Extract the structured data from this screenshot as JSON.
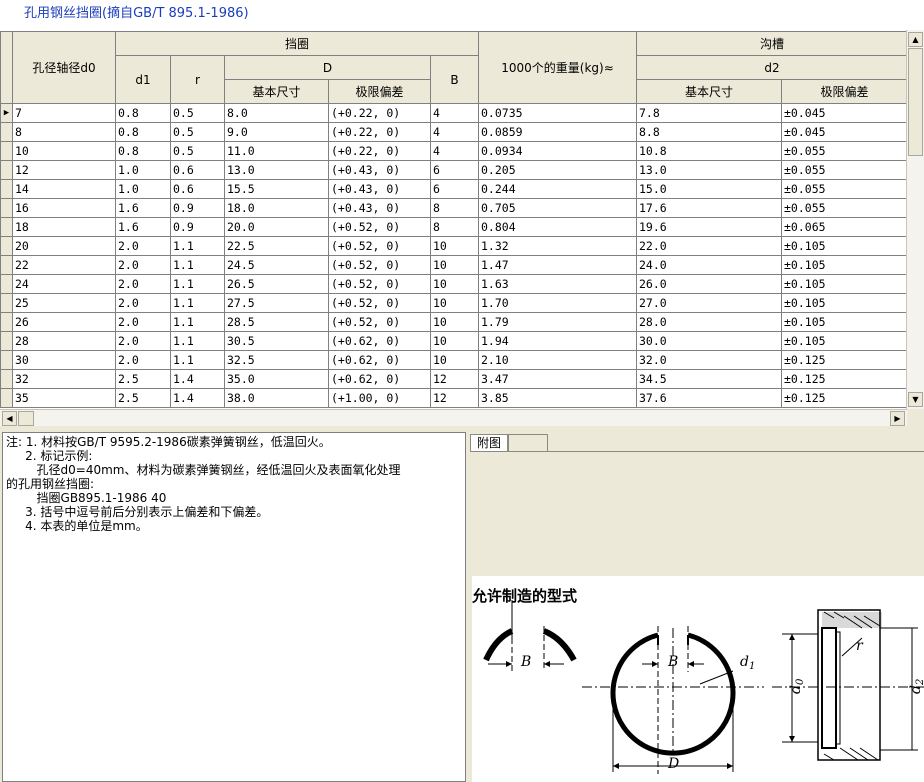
{
  "title": "孔用钢丝挡圈(摘自GB/T 895.1-1986)",
  "grid": {
    "headers": {
      "hole_dia": "孔径轴径d0",
      "ring": "挡圈",
      "d1": "d1",
      "r": "r",
      "D": "D",
      "basic": "基本尺寸",
      "tolerance": "极限偏差",
      "B": "B",
      "weight": "1000个的重量(kg)≈",
      "groove": "沟槽",
      "d2": "d2",
      "g_basic": "基本尺寸",
      "g_tolerance": "极限偏差"
    },
    "current_row_marker": "▶",
    "rows": [
      [
        "7",
        "0.8",
        "0.5",
        "8.0",
        "(+0.22, 0)",
        "4",
        "0.0735",
        "7.8",
        "±0.045"
      ],
      [
        "8",
        "0.8",
        "0.5",
        "9.0",
        "(+0.22, 0)",
        "4",
        "0.0859",
        "8.8",
        "±0.045"
      ],
      [
        "10",
        "0.8",
        "0.5",
        "11.0",
        "(+0.22, 0)",
        "4",
        "0.0934",
        "10.8",
        "±0.055"
      ],
      [
        "12",
        "1.0",
        "0.6",
        "13.0",
        "(+0.43, 0)",
        "6",
        "0.205",
        "13.0",
        "±0.055"
      ],
      [
        "14",
        "1.0",
        "0.6",
        "15.5",
        "(+0.43, 0)",
        "6",
        "0.244",
        "15.0",
        "±0.055"
      ],
      [
        "16",
        "1.6",
        "0.9",
        "18.0",
        "(+0.43, 0)",
        "8",
        "0.705",
        "17.6",
        "±0.055"
      ],
      [
        "18",
        "1.6",
        "0.9",
        "20.0",
        "(+0.52, 0)",
        "8",
        "0.804",
        "19.6",
        "±0.065"
      ],
      [
        "20",
        "2.0",
        "1.1",
        "22.5",
        "(+0.52, 0)",
        "10",
        "1.32",
        "22.0",
        "±0.105"
      ],
      [
        "22",
        "2.0",
        "1.1",
        "24.5",
        "(+0.52, 0)",
        "10",
        "1.47",
        "24.0",
        "±0.105"
      ],
      [
        "24",
        "2.0",
        "1.1",
        "26.5",
        "(+0.52, 0)",
        "10",
        "1.63",
        "26.0",
        "±0.105"
      ],
      [
        "25",
        "2.0",
        "1.1",
        "27.5",
        "(+0.52, 0)",
        "10",
        "1.70",
        "27.0",
        "±0.105"
      ],
      [
        "26",
        "2.0",
        "1.1",
        "28.5",
        "(+0.52, 0)",
        "10",
        "1.79",
        "28.0",
        "±0.105"
      ],
      [
        "28",
        "2.0",
        "1.1",
        "30.5",
        "(+0.62, 0)",
        "10",
        "1.94",
        "30.0",
        "±0.105"
      ],
      [
        "30",
        "2.0",
        "1.1",
        "32.5",
        "(+0.62, 0)",
        "10",
        "2.10",
        "32.0",
        "±0.125"
      ],
      [
        "32",
        "2.5",
        "1.4",
        "35.0",
        "(+0.62, 0)",
        "12",
        "3.47",
        "34.5",
        "±0.125"
      ],
      [
        "35",
        "2.5",
        "1.4",
        "38.0",
        "(+1.00, 0)",
        "12",
        "3.85",
        "37.6",
        "±0.125"
      ]
    ]
  },
  "notes": "注: 1. 材料按GB/T 9595.2-1986碳素弹簧钢丝，低温回火。\n     2. 标记示例:\n        孔径d0=40mm、材料为碳素弹簧钢丝，经低温回火及表面氧化处理\n的孔用钢丝挡圈:\n        挡圈GB895.1-1986 40\n     3. 括号中逗号前后分别表示上偏差和下偏差。\n     4. 本表的单位是mm。",
  "tabs": {
    "active": "附图",
    "second": ""
  },
  "figure": {
    "caption": "允许制造的型式",
    "label_B1": "B",
    "label_B2": "B",
    "label_d1": "d",
    "label_d1_sub": "1",
    "label_D": "D",
    "label_r": "r",
    "label_d0": "d",
    "label_d0_sub": "0",
    "label_d2": "d",
    "label_d2_sub": "2"
  }
}
